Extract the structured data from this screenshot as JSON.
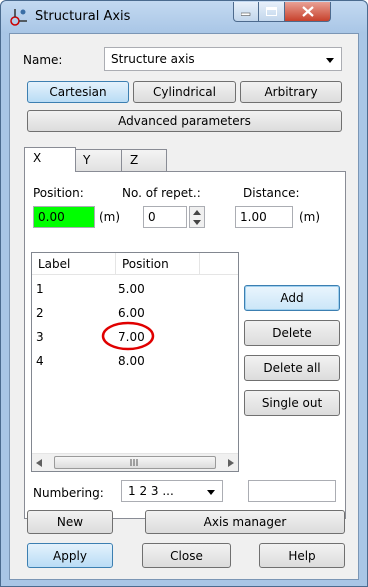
{
  "window": {
    "title": "Structural Axis",
    "icon": "structural-axis-app-icon"
  },
  "name_field": {
    "label": "Name:",
    "value": "Structure axis"
  },
  "coord_buttons": [
    "Cartesian",
    "Cylindrical",
    "Arbitrary"
  ],
  "advanced_label": "Advanced parameters",
  "tabs": [
    "X",
    "Y",
    "Z"
  ],
  "position": {
    "label": "Position:",
    "value": "0.00",
    "unit": "(m)"
  },
  "repetitions": {
    "label": "No. of repet.:",
    "value": "0"
  },
  "distance": {
    "label": "Distance:",
    "value": "1.00",
    "unit": "(m)"
  },
  "table": {
    "columns": [
      "Label",
      "Position"
    ],
    "rows": [
      {
        "label": "1",
        "position": "5.00"
      },
      {
        "label": "2",
        "position": "6.00"
      },
      {
        "label": "3",
        "position": "7.00"
      },
      {
        "label": "4",
        "position": "8.00"
      }
    ]
  },
  "side_buttons": [
    "Add",
    "Delete",
    "Delete all",
    "Single out"
  ],
  "numbering": {
    "label": "Numbering:",
    "value": "1 2 3 ..."
  },
  "bottom": {
    "new": "New",
    "axis_manager": "Axis manager",
    "apply": "Apply",
    "close": "Close",
    "help": "Help"
  },
  "colors": {
    "title_bar": "#a9c6e6",
    "selected_button": "#b9dcf5",
    "position_highlight": "#00ff00",
    "annotation_circle": "#e00000",
    "close_button": "#c7412c"
  }
}
